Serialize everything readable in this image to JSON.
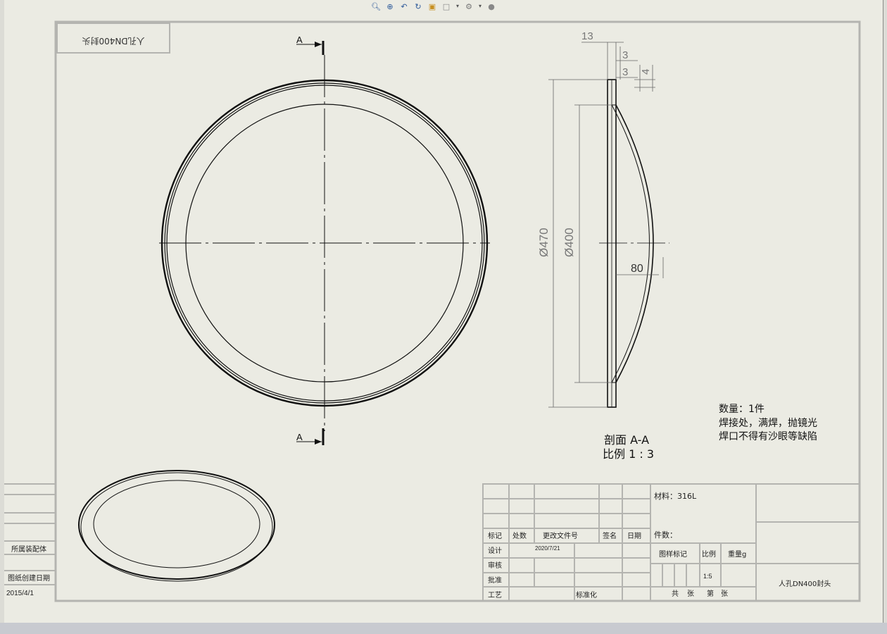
{
  "toolbar": {
    "icons": [
      "zoom-to-fit-icon",
      "zoom-area-icon",
      "previous-view-icon",
      "rebuild-icon",
      "shaded-view-icon",
      "hide-show-icon",
      "appearance-icon",
      "display-style-icon"
    ]
  },
  "drawing": {
    "rotated_part_label": "人孔DN400封头",
    "section_markers": {
      "top": "A",
      "bottom": "A"
    },
    "dimensions": {
      "d13": "13",
      "d3a": "3",
      "d3b": "3",
      "d4": "4",
      "d470": "Ø470",
      "d400": "Ø400",
      "d80": "80"
    },
    "section_label": "剖面 A-A",
    "scale_label": "比例 1 : 3",
    "notes": [
      "数量：1件",
      "焊接处，满焊，抛镜光",
      "焊口不得有沙眼等缺陷"
    ]
  },
  "left_block": {
    "assembly_label": "所属装配体",
    "created_label": "图纸创建日期",
    "created_date": "2015/4/1"
  },
  "title_block": {
    "header": {
      "mark": "标记",
      "count": "处数",
      "change_doc": "更改文件号",
      "signature": "签名",
      "date": "日期"
    },
    "roles": {
      "design": "设计",
      "review": "审核",
      "approve": "批准",
      "process": "工艺"
    },
    "design_date": "2020/7/21",
    "standardization": "标准化",
    "material": "材料：316L",
    "piece_count": "件数：",
    "drawing_mark": "图样标记",
    "scale_header": "比例",
    "weight_header": "重量g",
    "scale_value": "1:5",
    "sheets_total": "共",
    "sheets_unit1": "张",
    "sheet_no": "第",
    "sheets_unit2": "张",
    "part_name": "人孔DN400封头"
  }
}
